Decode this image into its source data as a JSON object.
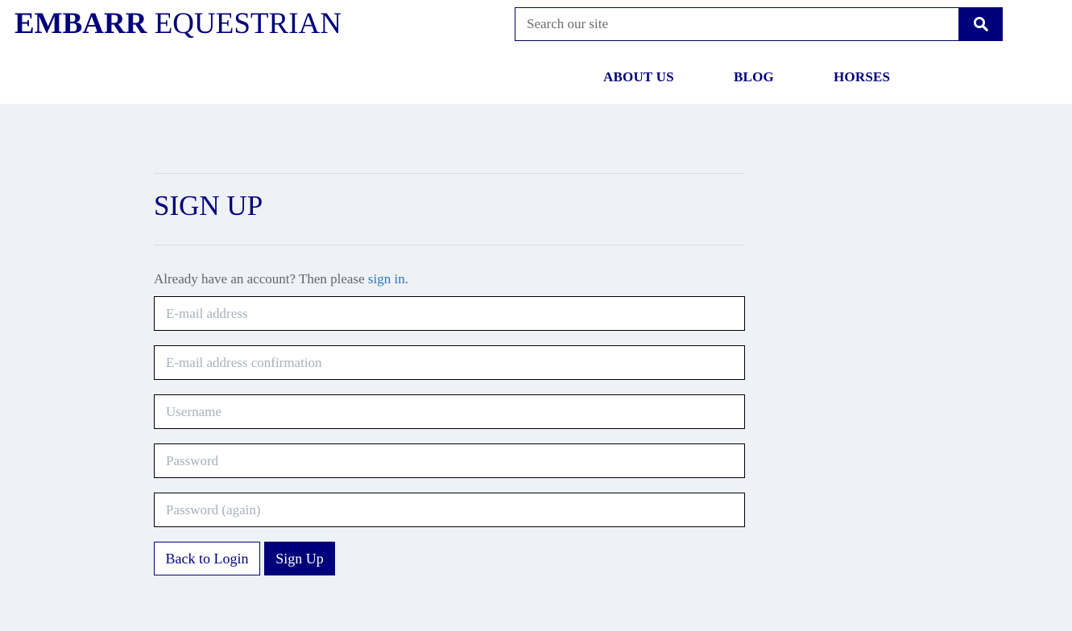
{
  "header": {
    "logo_bold": "EMBARR",
    "logo_rest": " EQUESTRIAN",
    "search_placeholder": "Search our site",
    "search_icon": "search-icon"
  },
  "nav": {
    "items": [
      {
        "label": "ABOUT US"
      },
      {
        "label": "BLOG"
      },
      {
        "label": "HORSES"
      }
    ]
  },
  "signup": {
    "title": "SIGN UP",
    "already_text": "Already have an account? Then please ",
    "sign_in_link": "sign in",
    "already_suffix": ".",
    "fields": {
      "email_placeholder": "E-mail address",
      "email_confirm_placeholder": "E-mail address confirmation",
      "username_placeholder": "Username",
      "password_placeholder": "Password",
      "password_again_placeholder": "Password (again)"
    },
    "back_button": "Back to Login",
    "signup_button": "Sign Up"
  },
  "colors": {
    "brand": "#00007a",
    "background": "#eef1f6",
    "link": "#2b78c2"
  }
}
